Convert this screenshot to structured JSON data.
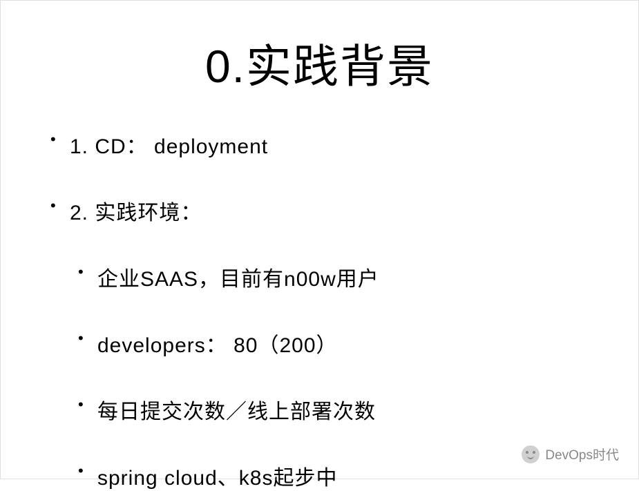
{
  "title": "0.实践背景",
  "bullets": {
    "item1": "1. CD： deployment",
    "item2": "2. 实践环境：",
    "sub1": "企业SAAS，目前有n00w用户",
    "sub2": "developers： 80（200）",
    "sub3": "每日提交次数／线上部署次数",
    "sub4": "spring cloud、k8s起步中"
  },
  "watermark": "DevOps时代"
}
